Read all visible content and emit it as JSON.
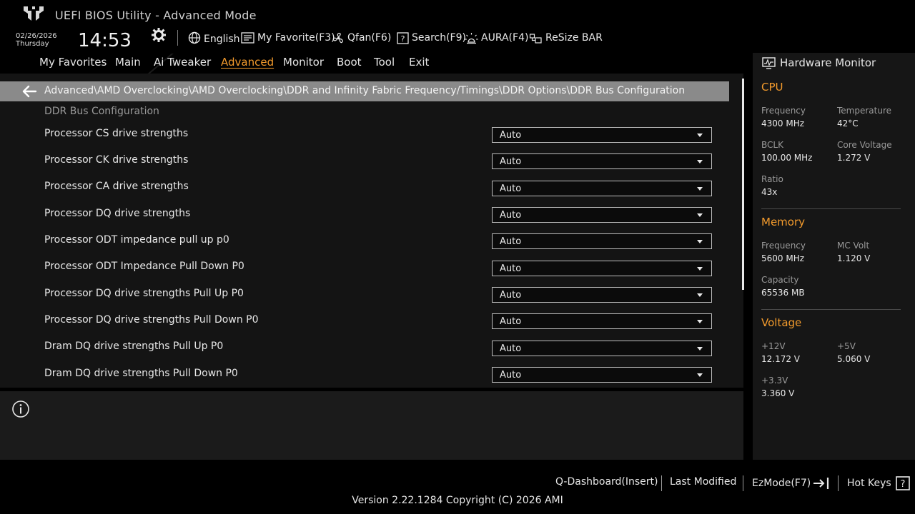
{
  "header": {
    "title": "UEFI BIOS Utility - Advanced Mode",
    "date": "02/26/2026",
    "day": "Thursday",
    "time": "14:53",
    "tools": [
      {
        "label": "English",
        "icon": "globe-icon"
      },
      {
        "label": "My Favorite(F3)",
        "icon": "favorite-list-icon"
      },
      {
        "label": "Qfan(F6)",
        "icon": "fan-icon"
      },
      {
        "label": "Search(F9)",
        "icon": "search-help-icon"
      },
      {
        "label": "AURA(F4)",
        "icon": "aura-light-icon"
      },
      {
        "label": "ReSize BAR",
        "icon": "resize-bar-icon"
      }
    ]
  },
  "tabs": [
    {
      "label": "My Favorites",
      "active": false
    },
    {
      "label": "Main",
      "active": false
    },
    {
      "label": "Ai Tweaker",
      "active": false
    },
    {
      "label": "Advanced",
      "active": true
    },
    {
      "label": "Monitor",
      "active": false
    },
    {
      "label": "Boot",
      "active": false
    },
    {
      "label": "Tool",
      "active": false
    },
    {
      "label": "Exit",
      "active": false
    }
  ],
  "breadcrumb": "Advanced\\AMD Overclocking\\AMD Overclocking\\DDR and Infinity Fabric Frequency/Timings\\DDR Options\\DDR Bus Configuration",
  "section_title": "DDR Bus Configuration",
  "settings": [
    {
      "label": "Processor CS drive strengths",
      "value": "Auto"
    },
    {
      "label": "Processor CK drive strengths",
      "value": "Auto"
    },
    {
      "label": "Processor CA drive strengths",
      "value": "Auto"
    },
    {
      "label": "Processor DQ drive strengths",
      "value": "Auto"
    },
    {
      "label": "Processor ODT impedance pull up p0",
      "value": "Auto"
    },
    {
      "label": "Processor ODT Impedance Pull Down P0",
      "value": "Auto"
    },
    {
      "label": "Processor DQ drive strengths Pull Up P0",
      "value": "Auto"
    },
    {
      "label": "Processor DQ drive strengths Pull Down P0",
      "value": "Auto"
    },
    {
      "label": "Dram DQ drive strengths Pull Up P0",
      "value": "Auto"
    },
    {
      "label": "Dram DQ drive strengths Pull Down P0",
      "value": "Auto"
    }
  ],
  "hardware_monitor": {
    "title": "Hardware Monitor",
    "cpu": {
      "heading": "CPU",
      "frequency_label": "Frequency",
      "frequency": "4300 MHz",
      "temperature_label": "Temperature",
      "temperature": "42°C",
      "bclk_label": "BCLK",
      "bclk": "100.00 MHz",
      "core_voltage_label": "Core Voltage",
      "core_voltage": "1.272 V",
      "ratio_label": "Ratio",
      "ratio": "43x"
    },
    "memory": {
      "heading": "Memory",
      "frequency_label": "Frequency",
      "frequency": "5600 MHz",
      "mc_volt_label": "MC Volt",
      "mc_volt": "1.120 V",
      "capacity_label": "Capacity",
      "capacity": "65536 MB"
    },
    "voltage": {
      "heading": "Voltage",
      "v12_label": "+12V",
      "v12": "12.172 V",
      "v5_label": "+5V",
      "v5": "5.060 V",
      "v33_label": "+3.3V",
      "v33": "3.360 V"
    }
  },
  "footer": {
    "qdashboard": "Q-Dashboard(Insert)",
    "last_modified": "Last Modified",
    "ezmode": "EzMode(F7)",
    "hotkeys": "Hot Keys",
    "version": "Version 2.22.1284 Copyright (C) 2026 AMI"
  },
  "colors": {
    "accent": "#f49b2c",
    "breadcrumb_bg": "#8a8a8a",
    "panel_bg": "#141414"
  }
}
